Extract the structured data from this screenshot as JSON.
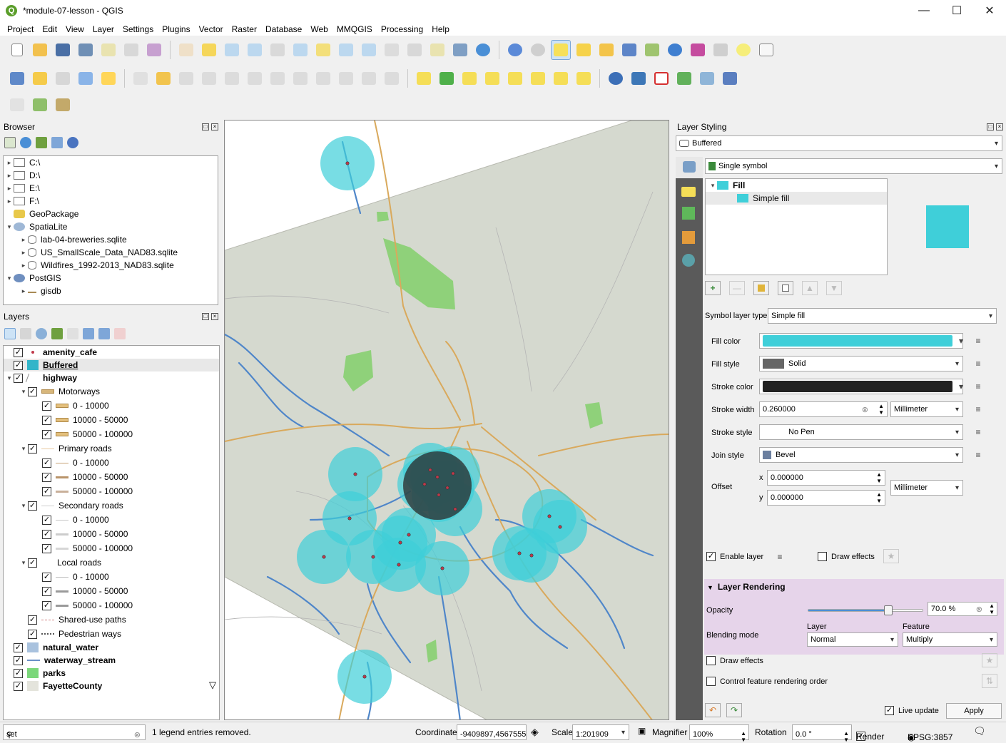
{
  "window": {
    "title": "*module-07-lesson - QGIS",
    "min": "—",
    "max": "☐",
    "close": "✕"
  },
  "menu": [
    "Project",
    "Edit",
    "View",
    "Layer",
    "Settings",
    "Plugins",
    "Vector",
    "Raster",
    "Database",
    "Web",
    "MMQGIS",
    "Processing",
    "Help"
  ],
  "browser": {
    "title": "Browser",
    "items": [
      {
        "label": "C:\\",
        "indent": 0,
        "icon": "folder",
        "arrow": "▸"
      },
      {
        "label": "D:\\",
        "indent": 0,
        "icon": "folder",
        "arrow": "▸"
      },
      {
        "label": "E:\\",
        "indent": 0,
        "icon": "folder",
        "arrow": "▸"
      },
      {
        "label": "F:\\",
        "indent": 0,
        "icon": "folder",
        "arrow": "▸"
      },
      {
        "label": "GeoPackage",
        "indent": 0,
        "icon": "geopackage",
        "arrow": ""
      },
      {
        "label": "SpatiaLite",
        "indent": 0,
        "icon": "spatialite",
        "arrow": "▾"
      },
      {
        "label": "lab-04-breweries.sqlite",
        "indent": 1,
        "icon": "db",
        "arrow": "▸"
      },
      {
        "label": "US_SmallScale_Data_NAD83.sqlite",
        "indent": 1,
        "icon": "db",
        "arrow": "▸"
      },
      {
        "label": "Wildfires_1992-2013_NAD83.sqlite",
        "indent": 1,
        "icon": "db",
        "arrow": "▸"
      },
      {
        "label": "PostGIS",
        "indent": 0,
        "icon": "postgis",
        "arrow": "▾"
      },
      {
        "label": "gisdb",
        "indent": 1,
        "icon": "conn",
        "arrow": "▸"
      }
    ]
  },
  "layers": {
    "title": "Layers",
    "items": [
      {
        "label": "amenity_cafe",
        "indent": 0,
        "bold": true,
        "arrow": "",
        "checked": true,
        "sym": "dot",
        "color": "#c0394a"
      },
      {
        "label": "Buffered",
        "indent": 0,
        "bold": true,
        "underline": true,
        "arrow": "",
        "checked": true,
        "sym": "fill",
        "color": "#33b5c9"
      },
      {
        "label": "highway",
        "indent": 0,
        "bold": true,
        "arrow": "▾",
        "checked": true,
        "sym": "line",
        "color": "#888888"
      },
      {
        "label": "Motorways",
        "indent": 1,
        "arrow": "▾",
        "checked": true,
        "sym": "bar",
        "color": "#d7b67a"
      },
      {
        "label": "0 - 10000",
        "indent": 2,
        "arrow": "",
        "checked": true,
        "sym": "bar",
        "color": "#e3bf7c"
      },
      {
        "label": "10000 - 50000",
        "indent": 2,
        "arrow": "",
        "checked": true,
        "sym": "bar",
        "color": "#e3bf7c"
      },
      {
        "label": "50000 - 100000",
        "indent": 2,
        "arrow": "",
        "checked": true,
        "sym": "bar",
        "color": "#e3bf7c"
      },
      {
        "label": "Primary roads",
        "indent": 1,
        "arrow": "▾",
        "checked": true,
        "sym": "thin",
        "color": "#e9caa2"
      },
      {
        "label": "0 - 10000",
        "indent": 2,
        "arrow": "",
        "checked": true,
        "sym": "thin",
        "color": "#c9a57a"
      },
      {
        "label": "10000 - 50000",
        "indent": 2,
        "arrow": "",
        "checked": true,
        "sym": "mid",
        "color": "#b9946a"
      },
      {
        "label": "50000 - 100000",
        "indent": 2,
        "arrow": "",
        "checked": true,
        "sym": "mid",
        "color": "#c9b09a"
      },
      {
        "label": "Secondary roads",
        "indent": 1,
        "arrow": "▾",
        "checked": true,
        "sym": "thin",
        "color": "#cfcfcf"
      },
      {
        "label": "0 - 10000",
        "indent": 2,
        "arrow": "",
        "checked": true,
        "sym": "thin",
        "color": "#c8c8c8"
      },
      {
        "label": "10000 - 50000",
        "indent": 2,
        "arrow": "",
        "checked": true,
        "sym": "mid",
        "color": "#cccccc"
      },
      {
        "label": "50000 - 100000",
        "indent": 2,
        "arrow": "",
        "checked": true,
        "sym": "mid",
        "color": "#d6d6d6"
      },
      {
        "label": "Local roads",
        "indent": 1,
        "arrow": "▾",
        "checked": true,
        "sym": "none",
        "color": "#ffffff"
      },
      {
        "label": "0 - 10000",
        "indent": 2,
        "arrow": "",
        "checked": true,
        "sym": "thin",
        "color": "#bdbdbd"
      },
      {
        "label": "10000 - 50000",
        "indent": 2,
        "arrow": "",
        "checked": true,
        "sym": "mid",
        "color": "#9a9a9a"
      },
      {
        "label": "50000 - 100000",
        "indent": 2,
        "arrow": "",
        "checked": true,
        "sym": "mid",
        "color": "#9a9a9a"
      },
      {
        "label": "Shared-use paths",
        "indent": 1,
        "arrow": "",
        "checked": true,
        "sym": "dash",
        "color": "#d08080"
      },
      {
        "label": "Pedestrian ways",
        "indent": 1,
        "arrow": "",
        "checked": true,
        "sym": "dots",
        "color": "#555555"
      },
      {
        "label": "natural_water",
        "indent": 0,
        "bold": true,
        "arrow": "",
        "checked": true,
        "sym": "fill",
        "color": "#a9c2de"
      },
      {
        "label": "waterway_stream",
        "indent": 0,
        "bold": true,
        "arrow": "",
        "checked": true,
        "sym": "line2",
        "color": "#6a8fc7"
      },
      {
        "label": "parks",
        "indent": 0,
        "bold": true,
        "arrow": "",
        "checked": true,
        "sym": "fill",
        "color": "#7bd77a"
      },
      {
        "label": "FayetteCounty",
        "indent": 0,
        "bold": true,
        "arrow": "",
        "checked": true,
        "sym": "fill",
        "color": "#e4e4dc"
      }
    ]
  },
  "styling": {
    "title": "Layer Styling",
    "layer_combo": "Buffered",
    "renderer": "Single symbol",
    "symbol_tree": {
      "fill": "Fill",
      "simple_fill": "Simple fill"
    },
    "symbol_layer_type_label": "Symbol layer type",
    "symbol_layer_type": "Simple fill",
    "fill_color_label": "Fill color",
    "fill_color": "#3fcfd9",
    "fill_style_label": "Fill style",
    "fill_style": "Solid",
    "stroke_color_label": "Stroke color",
    "stroke_color": "#222222",
    "stroke_width_label": "Stroke width",
    "stroke_width": "0.260000",
    "stroke_width_unit": "Millimeter",
    "stroke_style_label": "Stroke style",
    "stroke_style": "No Pen",
    "join_style_label": "Join style",
    "join_style": "Bevel",
    "offset_label": "Offset",
    "offset_x_label": "x",
    "offset_x": "0.000000",
    "offset_y_label": "y",
    "offset_y": "0.000000",
    "offset_unit": "Millimeter",
    "enable_layer": "Enable layer",
    "draw_effects": "Draw effects",
    "layer_rendering": "Layer Rendering",
    "opacity_label": "Opacity",
    "opacity": "70.0 %",
    "opacity_value": 0.7,
    "blending_label": "Blending mode",
    "blend_layer_label": "Layer",
    "blend_layer": "Normal",
    "blend_feature_label": "Feature",
    "blend_feature": "Multiply",
    "draw_effects2": "Draw effects",
    "control_order": "Control feature rendering order",
    "live_update": "Live update",
    "apply": "Apply"
  },
  "status": {
    "search": "set",
    "message": "1 legend entries removed.",
    "coordinate_label": "Coordinate",
    "coordinate": "-9409897,4567555",
    "scale_label": "Scale",
    "scale": "1:201909",
    "magnifier_label": "Magnifier",
    "magnifier": "100%",
    "rotation_label": "Rotation",
    "rotation": "0.0 °",
    "render": "Render",
    "crs": "EPSG:3857"
  },
  "colors": {
    "accent": "#33b5c9",
    "county": "#d9dcd4",
    "park": "#8fd17a",
    "water": "#4f86c9",
    "highlight": "#e6d4ea"
  }
}
